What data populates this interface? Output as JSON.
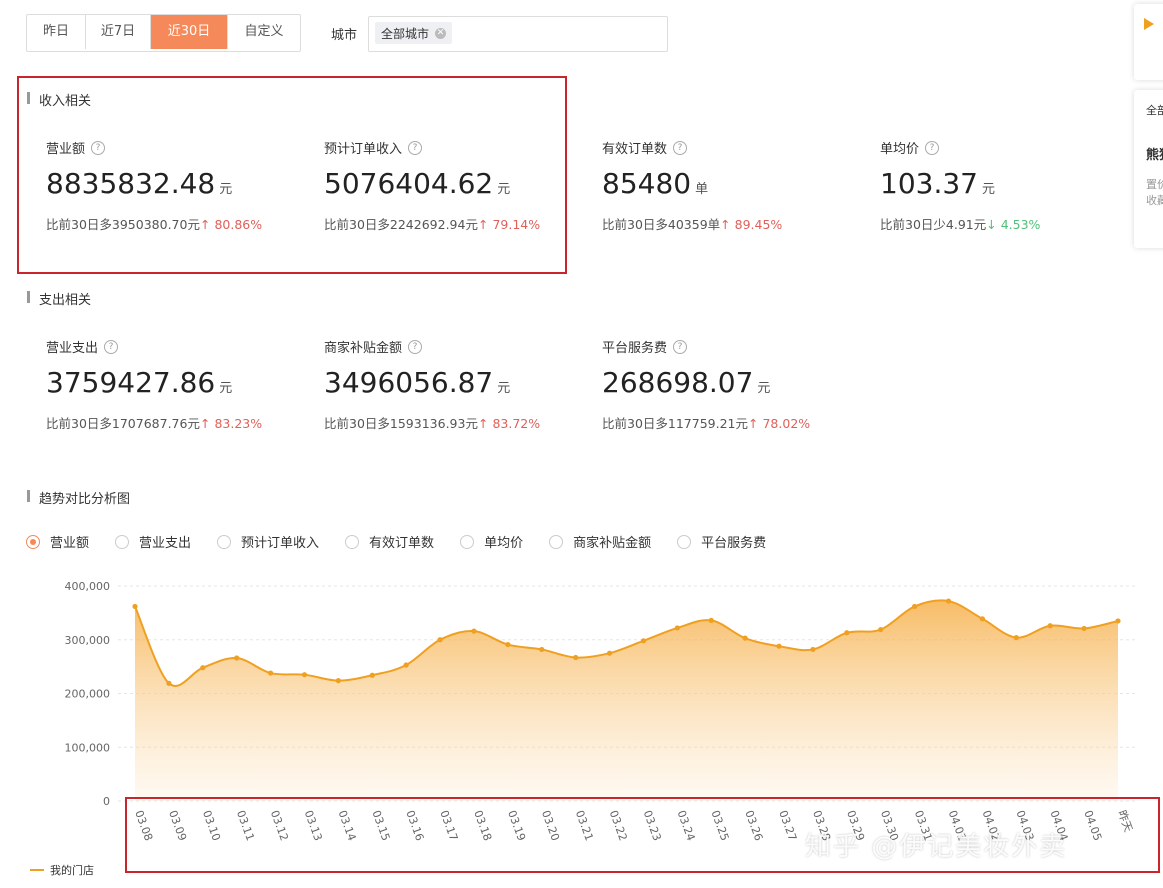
{
  "filters": {
    "date_tabs": [
      "昨日",
      "近7日",
      "近30日",
      "自定义"
    ],
    "active_tab": "近30日",
    "city_label": "城市",
    "city_tag": "全部城市"
  },
  "side_popup": {
    "line1": "全部",
    "line2": "熊猫",
    "line3": "置价",
    "line4": "收藏"
  },
  "income": {
    "title": "收入相关",
    "metrics": [
      {
        "name": "营业额",
        "value": "8835832.48",
        "unit": "元",
        "compare": "比前30日多3950380.70元",
        "arrow": "↑",
        "pct": "80.86%",
        "dir": "up"
      },
      {
        "name": "预计订单收入",
        "value": "5076404.62",
        "unit": "元",
        "compare": "比前30日多2242692.94元",
        "arrow": "↑",
        "pct": "79.14%",
        "dir": "up"
      },
      {
        "name": "有效订单数",
        "value": "85480",
        "unit": "单",
        "compare": "比前30日多40359单",
        "arrow": "↑",
        "pct": "89.45%",
        "dir": "up"
      },
      {
        "name": "单均价",
        "value": "103.37",
        "unit": "元",
        "compare": "比前30日少4.91元",
        "arrow": "↓",
        "pct": "4.53%",
        "dir": "down"
      }
    ]
  },
  "expense": {
    "title": "支出相关",
    "metrics": [
      {
        "name": "营业支出",
        "value": "3759427.86",
        "unit": "元",
        "compare": "比前30日多1707687.76元",
        "arrow": "↑",
        "pct": "83.23%",
        "dir": "up"
      },
      {
        "name": "商家补贴金额",
        "value": "3496056.87",
        "unit": "元",
        "compare": "比前30日多1593136.93元",
        "arrow": "↑",
        "pct": "83.72%",
        "dir": "up"
      },
      {
        "name": "平台服务费",
        "value": "268698.07",
        "unit": "元",
        "compare": "比前30日多117759.21元",
        "arrow": "↑",
        "pct": "78.02%",
        "dir": "up"
      }
    ]
  },
  "trend": {
    "title": "趋势对比分析图",
    "options": [
      "营业额",
      "营业支出",
      "预计订单收入",
      "有效订单数",
      "单均价",
      "商家补贴金额",
      "平台服务费"
    ],
    "selected": "营业额",
    "legend": "我的门店"
  },
  "chart_data": {
    "type": "area",
    "series": [
      {
        "name": "我的门店",
        "color": "#f0a020",
        "values": [
          362000,
          219000,
          248000,
          266000,
          238000,
          235000,
          224000,
          234000,
          253000,
          300000,
          316000,
          291000,
          282000,
          267000,
          275000,
          298000,
          322000,
          336000,
          303000,
          288000,
          282000,
          313000,
          319000,
          362000,
          372000,
          339000,
          304000,
          326000,
          321000,
          335000
        ]
      }
    ],
    "categories": [
      "03.08",
      "03.09",
      "03.10",
      "03.11",
      "03.12",
      "03.13",
      "03.14",
      "03.15",
      "03.16",
      "03.17",
      "03.18",
      "03.19",
      "03.20",
      "03.21",
      "03.22",
      "03.23",
      "03.24",
      "03.25",
      "03.26",
      "03.27",
      "03.28",
      "03.29",
      "03.30",
      "03.31",
      "04.01",
      "04.02",
      "04.03",
      "04.04",
      "04.05",
      "昨天"
    ],
    "yticks": [
      "0",
      "100,000",
      "200,000",
      "300,000",
      "400,000"
    ],
    "ylim": [
      0,
      400000
    ]
  },
  "watermark": "知乎 @伊记美妆外卖"
}
